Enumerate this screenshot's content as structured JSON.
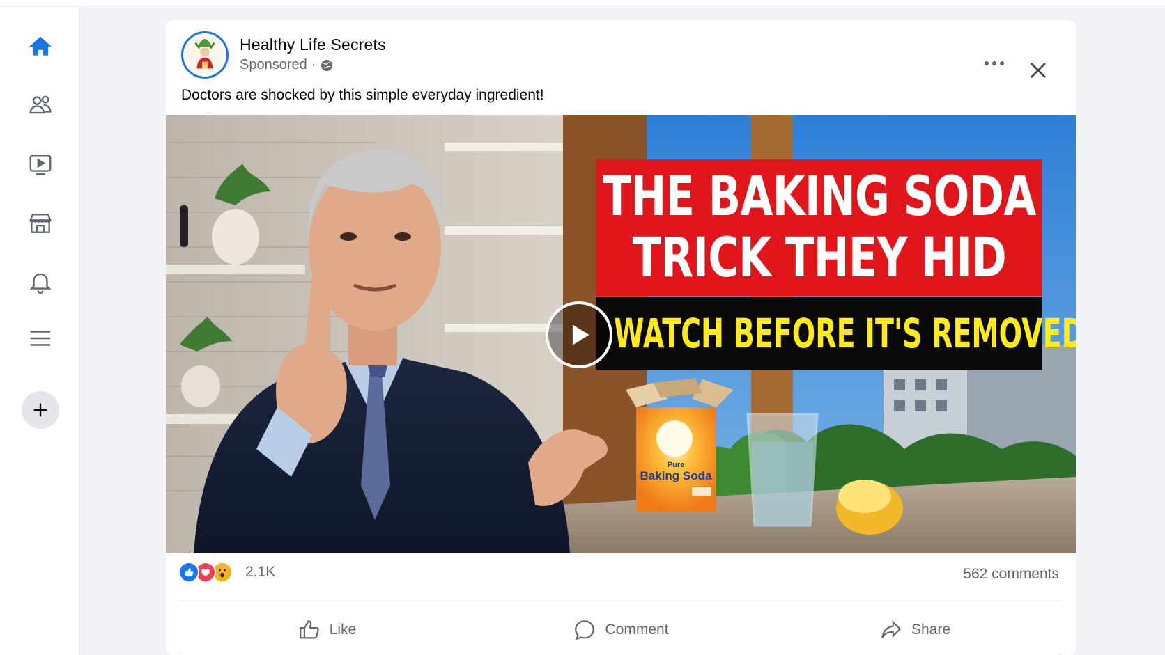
{
  "sidebar": {
    "items": [
      {
        "name": "home-icon",
        "active": true
      },
      {
        "name": "friends-icon"
      },
      {
        "name": "watch-icon"
      },
      {
        "name": "marketplace-icon"
      },
      {
        "name": "notifications-icon"
      },
      {
        "name": "menu-icon"
      },
      {
        "name": "plus-icon"
      }
    ]
  },
  "post": {
    "page_name": "Healthy Life Secrets",
    "sponsored_label": "Sponsored",
    "separator": "·",
    "privacy_icon": "globe-icon",
    "caption": "Doctors are shocked by this simple everyday ingredient!",
    "video": {
      "headline_line1": "THE BAKING SODA",
      "headline_line2": "TRICK THEY HID",
      "subheadline": "WATCH BEFORE IT'S REMOVED",
      "box_label_small": "Pure",
      "box_label": "Baking Soda"
    },
    "reactions": {
      "types": [
        "like",
        "love",
        "wow"
      ],
      "count": "2.1K"
    },
    "comments_label": "562 comments",
    "actions": {
      "like": "Like",
      "comment": "Comment",
      "share": "Share"
    }
  },
  "colors": {
    "accent": "#1b74e4",
    "headline_red": "#e0161b",
    "headline_yellow": "#ffeb1a",
    "secondary_text": "#65676b"
  }
}
